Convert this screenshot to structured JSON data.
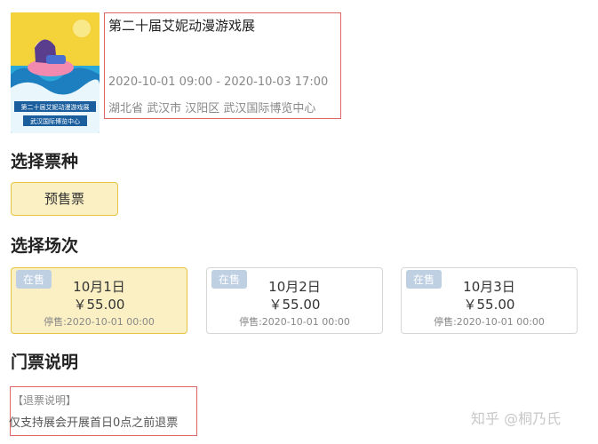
{
  "event": {
    "title": "第二十届艾妮动漫游戏展",
    "time": "2020-10-01 09:00 - 2020-10-03 17:00",
    "location": "湖北省 武汉市 汉阳区 武汉国际博览中心",
    "poster_icon": "event-poster"
  },
  "ticket_section": {
    "title": "选择票种",
    "options": [
      {
        "label": "预售票",
        "selected": true
      }
    ]
  },
  "session_section": {
    "title": "选择场次",
    "sessions": [
      {
        "badge": "在售",
        "date": "10月1日",
        "price": "￥55.00",
        "stop": "停售:2020-10-01 00:00",
        "selected": true
      },
      {
        "badge": "在售",
        "date": "10月2日",
        "price": "￥55.00",
        "stop": "停售:2020-10-01 00:00",
        "selected": false
      },
      {
        "badge": "在售",
        "date": "10月3日",
        "price": "￥55.00",
        "stop": "停售:2020-10-01 00:00",
        "selected": false
      }
    ]
  },
  "notes_section": {
    "title": "门票说明",
    "refund_heading": "【退票说明】",
    "refund_text": "仅支持展会开展首日0点之前退票"
  },
  "watermark": "知乎 @桐乃氏",
  "colors": {
    "selected_bg": "#fbf0c4",
    "selected_border": "#e7c445",
    "badge_bg": "#bfd0e2",
    "highlight_box": "#dd6666"
  }
}
